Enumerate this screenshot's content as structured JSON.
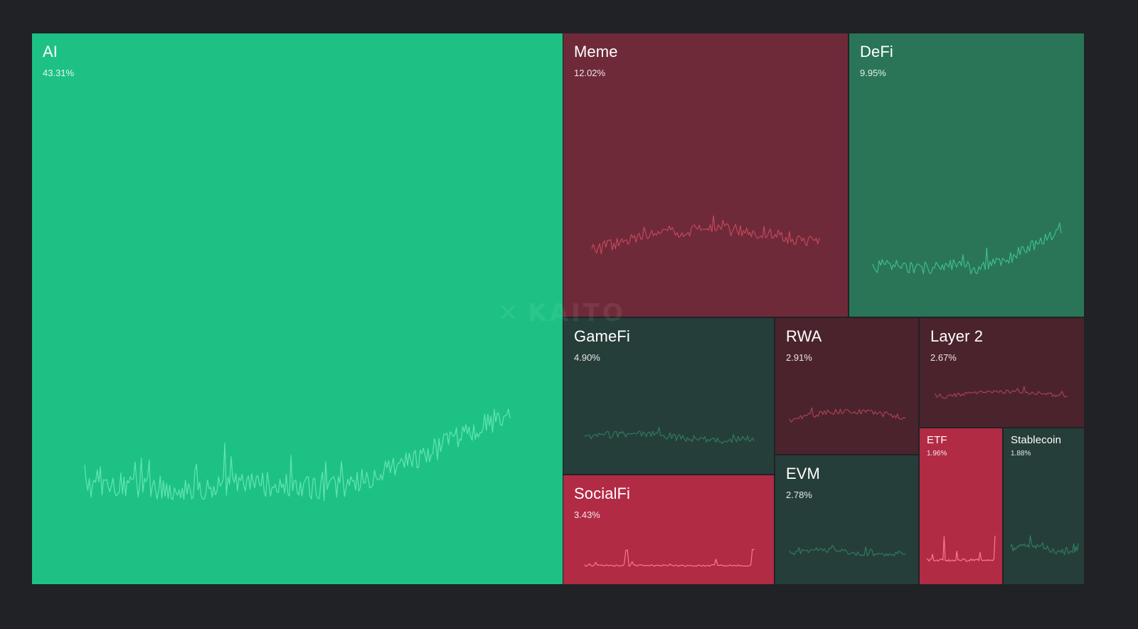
{
  "chart_data": {
    "type": "treemap",
    "title": "",
    "categories": [
      {
        "name": "AI",
        "value": 43.31,
        "share_label": "43.31%",
        "trend": "up",
        "color": "#1dc184",
        "line_color": "#5fe3b0"
      },
      {
        "name": "Meme",
        "value": 12.02,
        "share_label": "12.02%",
        "trend": "down",
        "color": "#6f2a39",
        "line_color": "#c9495e"
      },
      {
        "name": "DeFi",
        "value": 9.95,
        "share_label": "9.95%",
        "trend": "up",
        "color": "#2a7558",
        "line_color": "#3fc28f"
      },
      {
        "name": "GameFi",
        "value": 4.9,
        "share_label": "4.90%",
        "trend": "flat-up",
        "color": "#263e39",
        "line_color": "#2e7f62"
      },
      {
        "name": "RWA",
        "value": 2.91,
        "share_label": "2.91%",
        "trend": "down",
        "color": "#4b232d",
        "line_color": "#b04355"
      },
      {
        "name": "Layer 2",
        "value": 2.67,
        "share_label": "2.67%",
        "trend": "down",
        "color": "#4b232d",
        "line_color": "#b04355"
      },
      {
        "name": "SocialFi",
        "value": 3.43,
        "share_label": "3.43%",
        "trend": "strong-down",
        "color": "#b22b45",
        "line_color": "#ff7f93"
      },
      {
        "name": "EVM",
        "value": 2.78,
        "share_label": "2.78%",
        "trend": "flat-up",
        "color": "#263e39",
        "line_color": "#2e7f62"
      },
      {
        "name": "ETF",
        "value": 1.96,
        "share_label": "1.96%",
        "trend": "strong-down",
        "color": "#b22b45",
        "line_color": "#ff7f93"
      },
      {
        "name": "Stablecoin",
        "value": 1.88,
        "share_label": "1.88%",
        "trend": "flat-up",
        "color": "#263e39",
        "line_color": "#2e7f62"
      }
    ],
    "grid": false,
    "legend": "none"
  },
  "watermark": {
    "text": "KAITO",
    "icon": "kaito-logo-icon"
  }
}
